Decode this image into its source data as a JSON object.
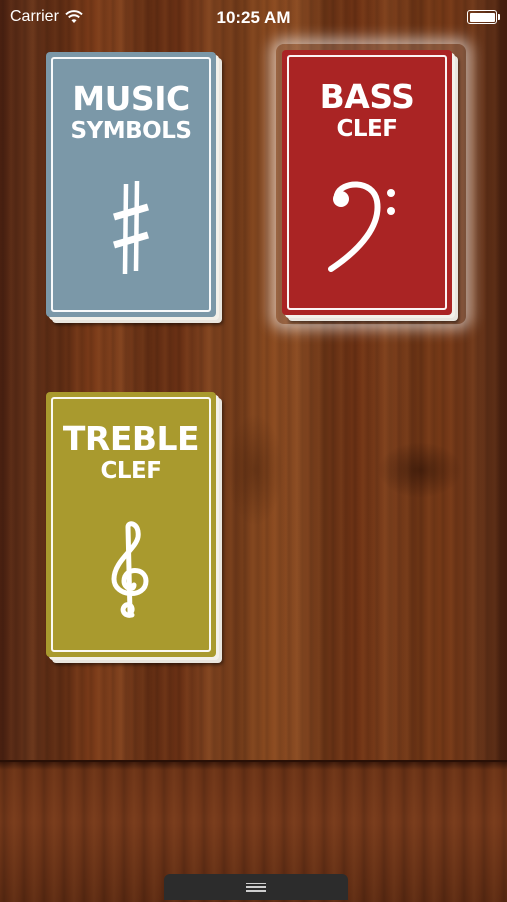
{
  "status_bar": {
    "carrier": "Carrier",
    "time": "10:25 AM",
    "icons": [
      "wifi-icon",
      "battery-icon"
    ]
  },
  "cards": [
    {
      "title": "MUSIC",
      "subtitle": "SYMBOLS",
      "icon": "sharp-icon",
      "color": "#7b98a8"
    },
    {
      "title": "BASS",
      "subtitle": "CLEF",
      "icon": "bass-clef-icon",
      "color": "#aa2424",
      "highlighted": true
    },
    {
      "title": "TREBLE",
      "subtitle": "CLEF",
      "icon": "treble-clef-icon",
      "color": "#a99a2e"
    }
  ],
  "drawer": {
    "icon": "grip-lines-icon"
  }
}
